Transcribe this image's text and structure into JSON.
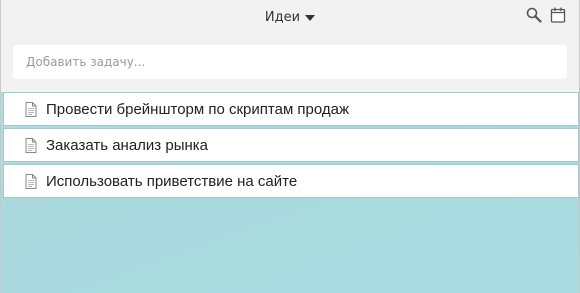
{
  "header": {
    "list_title": "Идеи",
    "icons": [
      "search-icon",
      "calendar-icon"
    ]
  },
  "add_task": {
    "placeholder": "Добавить задачу..."
  },
  "tasks": [
    {
      "label": "Провести брейншторм по скриптам продаж",
      "icon": "document-icon"
    },
    {
      "label": "Заказать анализ рынка",
      "icon": "document-icon"
    },
    {
      "label": "Использовать приветствие на сайте",
      "icon": "document-icon"
    }
  ],
  "colors": {
    "topbar": "#f2f2f2",
    "background": "#a9d8dd",
    "task_border": "#a8c7cb"
  }
}
